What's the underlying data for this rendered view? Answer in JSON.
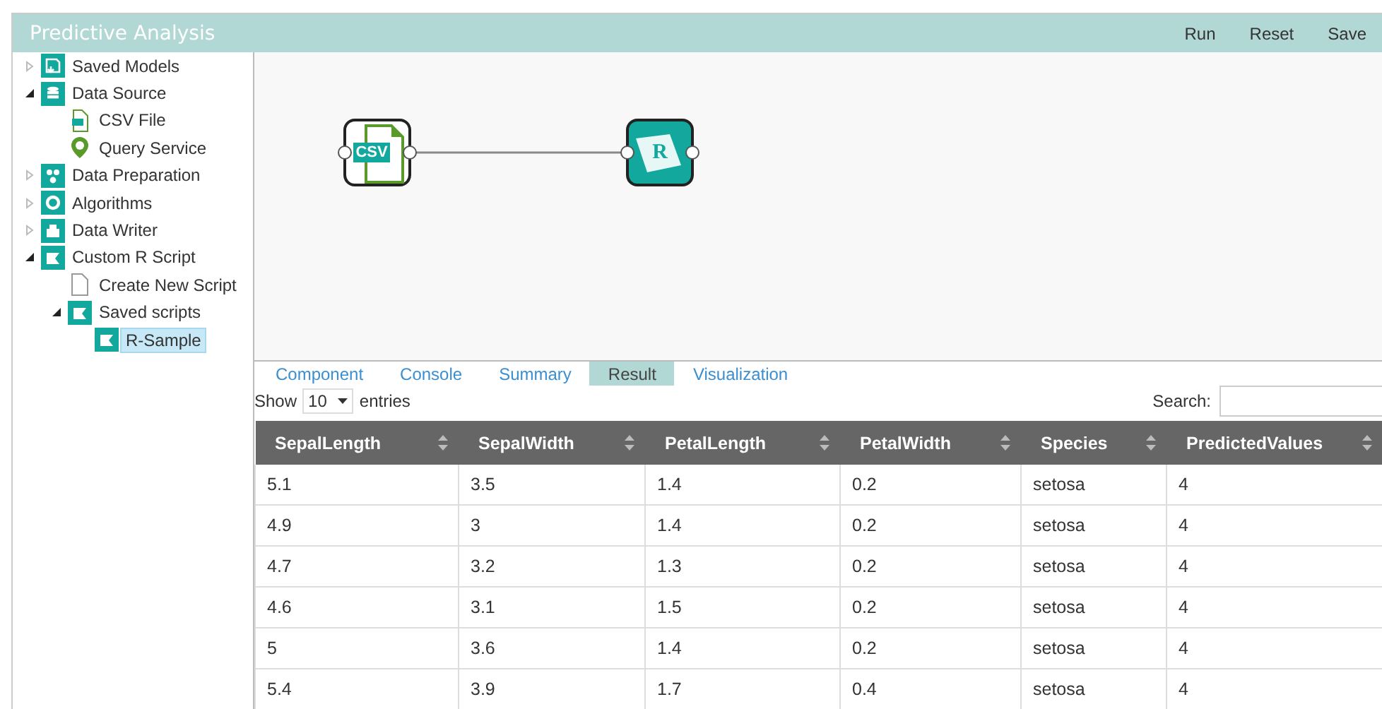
{
  "window": {
    "title": "Predictive Analysis"
  },
  "toolbar": [
    "Run",
    "Reset",
    "Save"
  ],
  "tree": [
    {
      "label": "Saved Models",
      "expanded": false,
      "selected": false
    },
    {
      "label": "Data Source",
      "expanded": true,
      "selected": false,
      "children": [
        {
          "label": "CSV File",
          "selected": false
        },
        {
          "label": "Query Service",
          "selected": false
        }
      ]
    },
    {
      "label": "Data Preparation",
      "expanded": false,
      "selected": false
    },
    {
      "label": "Algorithms",
      "expanded": false,
      "selected": false
    },
    {
      "label": "Data Writer",
      "expanded": false,
      "selected": false
    },
    {
      "label": "Custom R Script",
      "expanded": true,
      "selected": false,
      "children": [
        {
          "label": "Create New Script",
          "selected": false
        },
        {
          "label": "Saved scripts",
          "expanded": true,
          "selected": false,
          "children": [
            {
              "label": "R-Sample",
              "selected": true
            }
          ]
        }
      ]
    }
  ],
  "canvas": {
    "nodes": [
      {
        "kind": "csv",
        "label": "CSV"
      },
      {
        "kind": "r",
        "label": "R"
      }
    ]
  },
  "tabs": [
    {
      "label": "Component",
      "selected": false
    },
    {
      "label": "Console",
      "selected": false
    },
    {
      "label": "Summary",
      "selected": false
    },
    {
      "label": "Result",
      "selected": true
    },
    {
      "label": "Visualization",
      "selected": false
    }
  ],
  "table_controls": {
    "show_label": "Show",
    "page_size": "10",
    "entries_label": "entries",
    "search_label": "Search:"
  },
  "table": {
    "columns": [
      "SepalLength",
      "SepalWidth",
      "PetalLength",
      "PetalWidth",
      "Species",
      "PredictedValues"
    ],
    "rows": [
      [
        "5.1",
        "3.5",
        "1.4",
        "0.2",
        "setosa",
        "4"
      ],
      [
        "4.9",
        "3",
        "1.4",
        "0.2",
        "setosa",
        "4"
      ],
      [
        "4.7",
        "3.2",
        "1.3",
        "0.2",
        "setosa",
        "4"
      ],
      [
        "4.6",
        "3.1",
        "1.5",
        "0.2",
        "setosa",
        "4"
      ],
      [
        "5",
        "3.6",
        "1.4",
        "0.2",
        "setosa",
        "4"
      ],
      [
        "5.4",
        "3.9",
        "1.7",
        "0.4",
        "setosa",
        "4"
      ]
    ]
  }
}
